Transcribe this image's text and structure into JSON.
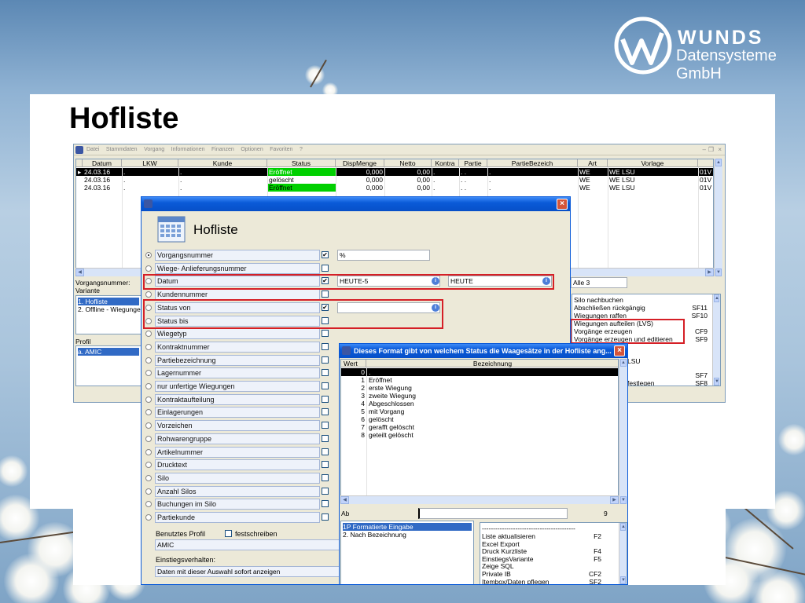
{
  "slide": {
    "title": "Hofliste",
    "logo_line1": "WUNDS",
    "logo_line2": "Datensysteme GmbH"
  },
  "main_window": {
    "menu": [
      "Datei",
      "Stammdaten",
      "Vorgang",
      "Informationen",
      "Finanzen",
      "Optionen",
      "Favoriten",
      "?"
    ],
    "columns": [
      "Datum",
      "LKW",
      "Kunde",
      "Status",
      "DispMenge",
      "Netto",
      "Kontra",
      "Partie",
      "PartieBezeich",
      "Art",
      "Vorlage"
    ],
    "rows": [
      {
        "datum": "24.03.16",
        "lkw": ".",
        "kunde": ".",
        "status": "Eröffnet",
        "disp": "0,000",
        "netto": "0,00",
        "kontra": ".",
        "partie": ". .",
        "partiebez": ".",
        "art": "WE",
        "vorlage": "WE LSU",
        "extra": "01V",
        "status_color": "#00d000"
      },
      {
        "datum": "24.03.16",
        "lkw": ".",
        "kunde": ".",
        "status": "gelöscht",
        "disp": "0,000",
        "netto": "0,00",
        "kontra": ".",
        "partie": ". .",
        "partiebez": ".",
        "art": "WE",
        "vorlage": "WE LSU",
        "extra": "01V",
        "status_color": ""
      },
      {
        "datum": "24.03.16",
        "lkw": ".",
        "kunde": ".",
        "status": "Eröffnet",
        "disp": "0,000",
        "netto": "0,00",
        "kontra": ".",
        "partie": ". .",
        "partiebez": ".",
        "art": "WE",
        "vorlage": "WE LSU",
        "extra": "01V",
        "status_color": "#00d000"
      }
    ],
    "vorgangsnummer_label": "Vorgangsnummer:",
    "variante_label": "Variante",
    "variante_items": [
      "1. Hofliste",
      "2. Offline - Wiegungen"
    ],
    "profil_label": "Profil",
    "profil_items": [
      "a. AMIC"
    ],
    "alle_label": "Alle 3",
    "functions": [
      {
        "label": "Silo nachbuchen",
        "key": ""
      },
      {
        "label": "Abschließen rückgängig",
        "key": "SF11"
      },
      {
        "label": "Wiegungen raffen",
        "key": "SF10"
      },
      {
        "label": "Wiegungen aufteilen (LVS)",
        "key": ""
      },
      {
        "label": "Vorgänge erzeugen",
        "key": "CF9"
      },
      {
        "label": "Vorgänge erzeugen und editieren",
        "key": "SF9"
      }
    ],
    "lower_functions": [
      {
        "label": "LSU",
        "key": ""
      },
      {
        "label": "",
        "key": "SF7"
      },
      {
        "label": "festlegen",
        "key": "SF8"
      }
    ]
  },
  "hofliste_dialog": {
    "title": "Hofliste",
    "fields": [
      {
        "label": "Vorgangsnummer",
        "radio": true,
        "check": "✔",
        "value1": "%",
        "value2": ""
      },
      {
        "label": "Wiege- Anlieferungsnummer",
        "radio": false,
        "check": "",
        "value1": "",
        "value2": ""
      },
      {
        "label": "Datum",
        "radio": false,
        "check": "✔",
        "value1": "HEUTE-5",
        "value2": "HEUTE"
      },
      {
        "label": "Kundennummer",
        "radio": false,
        "check": "",
        "value1": "",
        "value2": ""
      },
      {
        "label": "Status von",
        "radio": false,
        "check": "✔",
        "value1": "",
        "value2": ""
      },
      {
        "label": "Status bis",
        "radio": false,
        "check": "",
        "value1": "",
        "value2": ""
      },
      {
        "label": "Wiegetyp",
        "radio": false,
        "check": "",
        "value1": "",
        "value2": ""
      },
      {
        "label": "Kontraktnummer",
        "radio": false,
        "check": "",
        "value1": "",
        "value2": ""
      },
      {
        "label": "Partiebezeichnung",
        "radio": false,
        "check": "",
        "value1": "",
        "value2": ""
      },
      {
        "label": "Lagernummer",
        "radio": false,
        "check": "",
        "value1": "",
        "value2": ""
      },
      {
        "label": "nur unfertige Wiegungen",
        "radio": false,
        "check": "",
        "value1": "",
        "value2": ""
      },
      {
        "label": "Kontraktaufteilung",
        "radio": false,
        "check": "",
        "value1": "",
        "value2": ""
      },
      {
        "label": "Einlagerungen",
        "radio": false,
        "check": "",
        "value1": "",
        "value2": ""
      },
      {
        "label": "Vorzeichen",
        "radio": false,
        "check": "",
        "value1": "",
        "value2": ""
      },
      {
        "label": "Rohwarengruppe",
        "radio": false,
        "check": "",
        "value1": "",
        "value2": ""
      },
      {
        "label": "Artikelnummer",
        "radio": false,
        "check": "",
        "value1": "",
        "value2": ""
      },
      {
        "label": "Drucktext",
        "radio": false,
        "check": "",
        "value1": "",
        "value2": ""
      },
      {
        "label": "Silo",
        "radio": false,
        "check": "",
        "value1": "",
        "value2": ""
      },
      {
        "label": "Anzahl Silos",
        "radio": false,
        "check": "",
        "value1": "",
        "value2": ""
      },
      {
        "label": "Buchungen im Silo",
        "radio": false,
        "check": "",
        "value1": "",
        "value2": ""
      },
      {
        "label": "Partiekunde",
        "radio": false,
        "check": "",
        "value1": "",
        "value2": ""
      }
    ],
    "benutztes_profil_label": "Benutztes Profil",
    "festschreiben_label": "festschreiben",
    "profil_value": "AMIC",
    "einstieg_label": "Einstiegsverhalten:",
    "einstieg_value": "Daten mit dieser Auswahl sofort anzeigen"
  },
  "status_dialog": {
    "title": "Dieses Format gibt von  welchem Status die Waagesätze in der Hofliste ang...",
    "col_wert": "Wert",
    "col_bez": "Bezeichnung",
    "rows": [
      {
        "wert": "0",
        "bez": "."
      },
      {
        "wert": "1",
        "bez": "Eröffnet"
      },
      {
        "wert": "2",
        "bez": "erste Wiegung"
      },
      {
        "wert": "3",
        "bez": "zweite Wiegung"
      },
      {
        "wert": "4",
        "bez": "Abgeschlossen"
      },
      {
        "wert": "5",
        "bez": "mit Vorgang"
      },
      {
        "wert": "6",
        "bez": "gelöscht"
      },
      {
        "wert": "7",
        "bez": "gerafft gelöscht"
      },
      {
        "wert": "8",
        "bez": "geteilt gelöscht"
      }
    ],
    "ab_label": "Ab",
    "ab_count": "9",
    "modes": [
      "1P Formatierte Eingabe",
      "2. Nach Bezeichnung"
    ],
    "separator": "------------------------------------------",
    "functions": [
      {
        "label": "Liste aktualisieren",
        "key": "F2"
      },
      {
        "label": "Excel Export",
        "key": ""
      },
      {
        "label": "Druck Kurzliste",
        "key": "F4"
      },
      {
        "label": "EinstiegsVariante",
        "key": "F5"
      },
      {
        "label": "Zeige SQL",
        "key": ""
      },
      {
        "label": "Private IB",
        "key": "CF2"
      },
      {
        "label": "Itembox/Daten pflegen",
        "key": "SF2"
      }
    ]
  },
  "colors": {
    "red_highlight": "#d51f26",
    "title_blue": "#0a5ad8",
    "selection": "#316ac5",
    "status_green": "#00d000"
  }
}
